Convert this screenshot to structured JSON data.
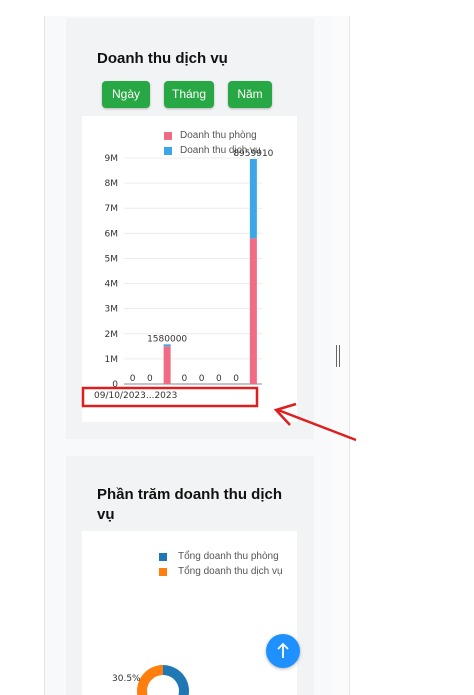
{
  "panel_revenue": {
    "title": "Doanh thu dịch vụ",
    "buttons": [
      "Ngày",
      "Tháng",
      "Năm"
    ]
  },
  "panel_percent": {
    "title": "Phần trăm doanh thu dịch vụ"
  },
  "colors": {
    "room": "#f26b85",
    "service": "#3ba7e8",
    "pie_room": "#1f77b4",
    "pie_service": "#ff7f0e",
    "button": "#28a745",
    "annotation": "#dd1f1f",
    "fab": "#1e90ff"
  },
  "chart_data": [
    {
      "type": "bar",
      "stacked": true,
      "legend": [
        "Doanh thu phòng",
        "Doanh thu dịch vụ"
      ],
      "legend_position": "top",
      "y_ticks": [
        "0",
        "1M",
        "2M",
        "3M",
        "4M",
        "5M",
        "6M",
        "7M",
        "8M",
        "9M"
      ],
      "ylim": [
        0,
        9000000
      ],
      "x_tick_text": "09/10/2023...2023",
      "bar_labels": [
        "0",
        "0",
        "1580000",
        "0",
        "0",
        "0",
        "0",
        "8959910"
      ],
      "series": [
        {
          "name": "Doanh thu phòng",
          "values": [
            0,
            0,
            1500000,
            0,
            0,
            0,
            0,
            5800000
          ]
        },
        {
          "name": "Doanh thu dịch vụ",
          "values": [
            0,
            0,
            80000,
            0,
            0,
            0,
            0,
            3159910
          ]
        }
      ]
    },
    {
      "type": "pie",
      "legend": [
        "Tổng doanh thu phòng",
        "Tổng doanh thu dịch vụ"
      ],
      "legend_position": "top",
      "visible_label": "30.5%",
      "slices": [
        {
          "name": "Tổng doanh thu phòng",
          "value": 69.5
        },
        {
          "name": "Tổng doanh thu dịch vụ",
          "value": 30.5
        }
      ]
    }
  ],
  "fab": {
    "icon": "arrow-up-icon"
  },
  "annotation": {
    "type": "red-box-with-arrow",
    "target": "x-axis-labels"
  }
}
